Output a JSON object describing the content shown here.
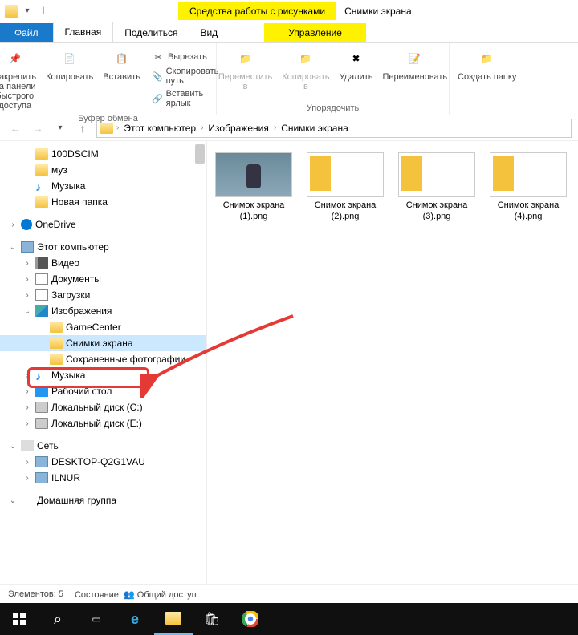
{
  "titlebar": {
    "context_tab": "Средства работы с рисунками",
    "title": "Снимки экрана"
  },
  "tabs": {
    "file": "Файл",
    "home": "Главная",
    "share": "Поделиться",
    "view": "Вид",
    "manage": "Управление"
  },
  "ribbon": {
    "pin": "Закрепить на панели\nбыстрого доступа",
    "copy": "Копировать",
    "paste": "Вставить",
    "cut": "Вырезать",
    "copy_path": "Скопировать путь",
    "paste_shortcut": "Вставить ярлык",
    "clipboard_group": "Буфер обмена",
    "move_to": "Переместить в",
    "copy_to": "Копировать в",
    "delete": "Удалить",
    "rename": "Переименовать",
    "organize_group": "Упорядочить",
    "new_folder": "Создать папку"
  },
  "breadcrumb": {
    "pc": "Этот компьютер",
    "pictures": "Изображения",
    "screenshots": "Снимки экрана"
  },
  "tree": {
    "dscim": "100DSCIM",
    "muz": "муз",
    "music": "Музыка",
    "new_folder": "Новая папка",
    "onedrive": "OneDrive",
    "this_pc": "Этот компьютер",
    "video": "Видео",
    "documents": "Документы",
    "downloads": "Загрузки",
    "images": "Изображения",
    "gamecenter": "GameCenter",
    "screenshots": "Снимки экрана",
    "saved_photos": "Сохраненные фотографии",
    "music2": "Музыка",
    "desktop": "Рабочий стол",
    "disk_c": "Локальный диск (C:)",
    "disk_e": "Локальный диск (E:)",
    "network": "Сеть",
    "desktop_q": "DESKTOP-Q2G1VAU",
    "ilnur": "ILNUR",
    "homegroup": "Домашняя группа"
  },
  "files": [
    {
      "name": "Снимок экрана (1).png",
      "thumb": "img1"
    },
    {
      "name": "Снимок экрана (2).png",
      "thumb": "shot"
    },
    {
      "name": "Снимок экрана (3).png",
      "thumb": "shot"
    },
    {
      "name": "Снимок экрана (4).png",
      "thumb": "shot"
    }
  ],
  "status": {
    "items": "Элементов: 5",
    "state": "Состояние:",
    "shared": "Общий доступ"
  }
}
